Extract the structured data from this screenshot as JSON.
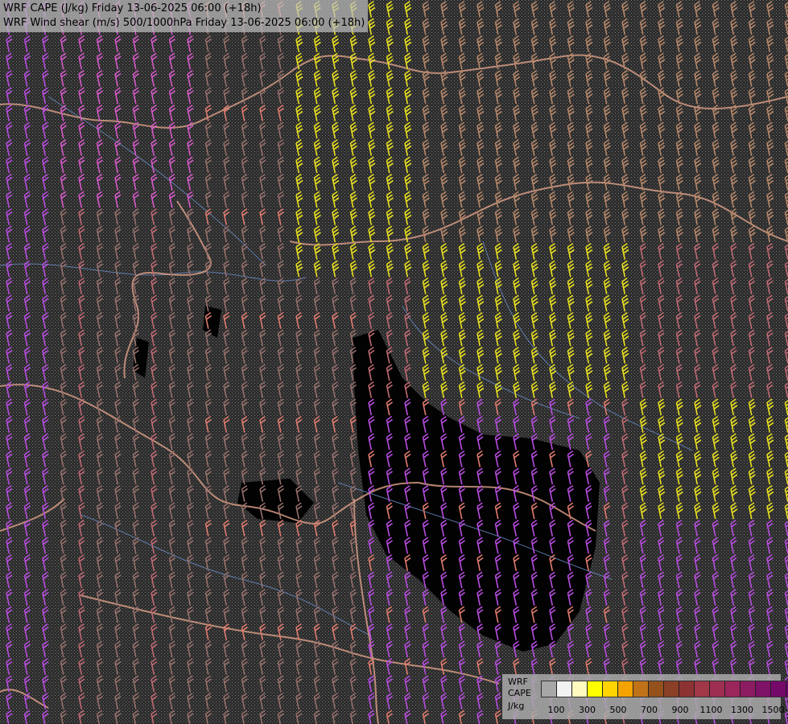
{
  "header": {
    "title_line1": "WRF CAPE (J/kg) Friday 13-06-2025 06:00 (+18h)",
    "title_line2": "WRF Wind shear (m/s) 500/1000hPa Friday 13-06-2025 06:00 (+18h)"
  },
  "legend": {
    "line1": "WRF",
    "line2": "CAPE",
    "line3": "J/kg",
    "colors": [
      "#a7a7a7",
      "#f2f2f2",
      "#fffbbf",
      "#ffff00",
      "#ffd400",
      "#f5a300",
      "#c07218",
      "#94511c",
      "#8b3f27",
      "#8c3232",
      "#a03848",
      "#9e2f52",
      "#9a265c",
      "#8c1c61",
      "#7e1266",
      "#75096a",
      "#6d0070"
    ],
    "ticks": [
      "100",
      "300",
      "500",
      "700",
      "900",
      "1100",
      "1300",
      "1500"
    ]
  },
  "layers": {
    "barb_colors": {
      "shear_low": "#b84de0",
      "shear_mid": "#d65ac9",
      "shear_rose": "#c06a73",
      "shear_salmon": "#e07c70",
      "shear_brown": "#96706b",
      "shear_tan": "#b5876a",
      "shear_yellow": "#e8e020"
    },
    "border_color": "#e0a28a",
    "river_color": "#6b8fc9"
  }
}
